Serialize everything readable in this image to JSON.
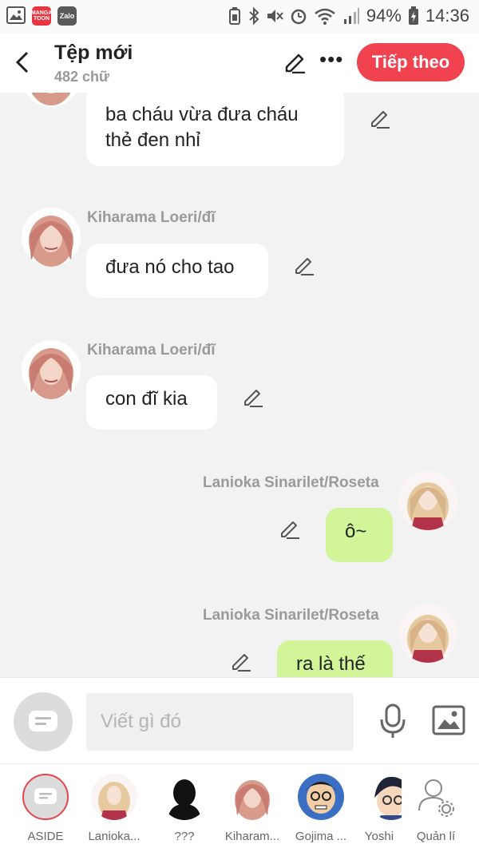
{
  "status_bar": {
    "apps": [
      "MANGA TOON",
      "Zalo"
    ],
    "battery": "94%",
    "time": "14:36"
  },
  "header": {
    "title": "Tệp mới",
    "word_count": "482 chữ",
    "next_label": "Tiếp theo"
  },
  "messages": [
    {
      "side": "left",
      "name": "",
      "lines": [
        "ba cháu vừa đưa cháu",
        "thẻ đen nhỉ"
      ]
    },
    {
      "side": "left",
      "name": "Kiharama Loeri/đĩ",
      "lines": [
        "đưa nó cho tao"
      ]
    },
    {
      "side": "left",
      "name": "Kiharama Loeri/đĩ",
      "lines": [
        "con đĩ kia"
      ]
    },
    {
      "side": "right",
      "name": "Lanioka Sinarilet/Roseta",
      "lines": [
        "ô~"
      ]
    },
    {
      "side": "right",
      "name": "Lanioka Sinarilet/Roseta",
      "lines": [
        "ra là thế"
      ]
    }
  ],
  "composer": {
    "placeholder": "Viết gì đó"
  },
  "characters": [
    {
      "label": "ASIDE"
    },
    {
      "label": "Lanioka..."
    },
    {
      "label": "???"
    },
    {
      "label": "Kiharam..."
    },
    {
      "label": "Gojima ..."
    },
    {
      "label": "Yoshi"
    },
    {
      "label": "Quản lí"
    }
  ],
  "colors": {
    "accent": "#f0424f",
    "right_bubble": "#d3f59a",
    "background": "#f2f2f2"
  }
}
